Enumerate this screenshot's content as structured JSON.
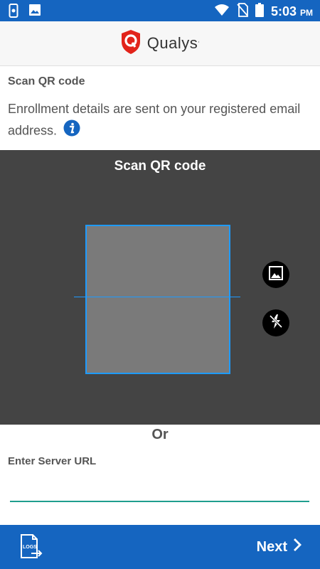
{
  "status_bar": {
    "time": "5:03",
    "ampm": "PM",
    "icons": [
      "phone-settings-icon",
      "image-icon",
      "wifi-icon",
      "no-sim-icon",
      "battery-icon"
    ]
  },
  "header": {
    "brand": "Qualys",
    "trademark": ".",
    "logo_color": "#e2231a"
  },
  "intro": {
    "title": "Scan QR code",
    "description": "Enrollment details are sent on your registered email address."
  },
  "scanner": {
    "title": "Scan QR code",
    "frame_color": "#1e9bff",
    "buttons": [
      "gallery-icon",
      "flash-off-icon"
    ]
  },
  "divider_text": "Or",
  "server_url": {
    "label": "Enter Server URL",
    "value": "",
    "placeholder": ""
  },
  "bottom_bar": {
    "logs_label": "LOGS",
    "next_label": "Next",
    "color": "#1565c0"
  }
}
